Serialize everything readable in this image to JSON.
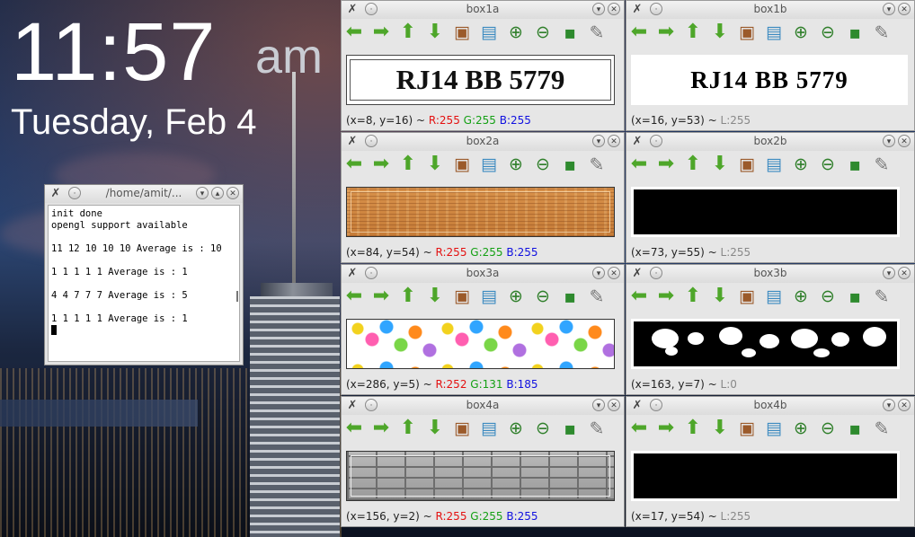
{
  "clock": {
    "time": "11:57",
    "ampm": "am",
    "date": "Tuesday, Feb 4"
  },
  "terminal": {
    "title": "/home/amit/...",
    "lines": [
      "init done",
      "opengl support available",
      "",
      "11 12 10 10 10 Average is : 10",
      "",
      "1 1 1 1 1 Average is : 1",
      "",
      "4 4 7 7 7 Average is : 5",
      "",
      "1 1 1 1 1 Average is : 1"
    ]
  },
  "toolbar_icons": [
    "arrow-left-icon",
    "arrow-right-icon",
    "arrow-up-icon",
    "arrow-down-icon",
    "image-icon",
    "picture-icon",
    "zoom-in-icon",
    "zoom-out-icon",
    "save-icon",
    "brush-icon"
  ],
  "windows": {
    "box1a": {
      "title": "box1a",
      "status": {
        "coords": "(x=8, y=16) ~ ",
        "r": "R:255",
        "g": "G:255",
        "b": "B:255"
      },
      "plate_text": "RJ14 BB 5779"
    },
    "box1b": {
      "title": "box1b",
      "status": {
        "coords": "(x=16, y=53) ~ ",
        "l": "L:255"
      },
      "plate_text": "RJ14 BB 5779"
    },
    "box2a": {
      "title": "box2a",
      "status": {
        "coords": "(x=84, y=54) ~ ",
        "r": "R:255",
        "g": "G:255",
        "b": "B:255"
      }
    },
    "box2b": {
      "title": "box2b",
      "status": {
        "coords": "(x=73, y=55) ~ ",
        "l": "L:255"
      }
    },
    "box3a": {
      "title": "box3a",
      "status": {
        "coords": "(x=286, y=5) ~ ",
        "r": "R:252",
        "g": "G:131",
        "b": "B:185"
      }
    },
    "box3b": {
      "title": "box3b",
      "status": {
        "coords": "(x=163, y=7) ~ ",
        "l": "L:0"
      }
    },
    "box4a": {
      "title": "box4a",
      "status": {
        "coords": "(x=156, y=2) ~ ",
        "r": "R:255",
        "g": "G:255",
        "b": "B:255"
      }
    },
    "box4b": {
      "title": "box4b",
      "status": {
        "coords": "(x=17, y=54) ~ ",
        "l": "L:255"
      }
    }
  },
  "colors": {
    "red": "#e41010",
    "green": "#14a014",
    "blue": "#1010e0",
    "gray": "#888888"
  }
}
